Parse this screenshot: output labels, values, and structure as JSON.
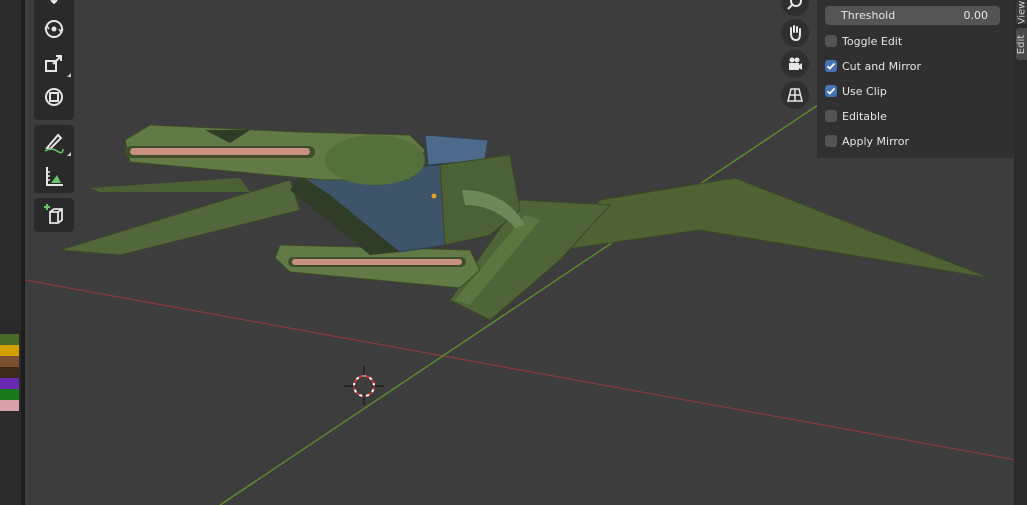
{
  "panel": {
    "threshold_label": "Threshold",
    "threshold_value": "0.00",
    "options": [
      {
        "label": "Toggle Edit",
        "checked": false
      },
      {
        "label": "Cut and Mirror",
        "checked": true
      },
      {
        "label": "Use Clip",
        "checked": true
      },
      {
        "label": "Editable",
        "checked": false
      },
      {
        "label": "Apply Mirror",
        "checked": false
      }
    ]
  },
  "tabs": {
    "view": "View",
    "edit": "Edit"
  },
  "toolbar": {
    "tools": [
      "move-tool",
      "rotate-tool",
      "scale-tool",
      "transform-tool",
      "annotate-tool",
      "measure-tool",
      "add-cube-tool"
    ]
  },
  "navigation": {
    "buttons": [
      "zoom-icon",
      "hand-pan-icon",
      "camera-icon",
      "grid-perspective-icon"
    ]
  },
  "palette": {
    "colors": [
      "#2a2a2a",
      "#4a6a2a",
      "#d4a000",
      "#7a5030",
      "#3a2a1a",
      "#6a2ab0",
      "#1a7a1a",
      "#d8a0a8"
    ]
  }
}
